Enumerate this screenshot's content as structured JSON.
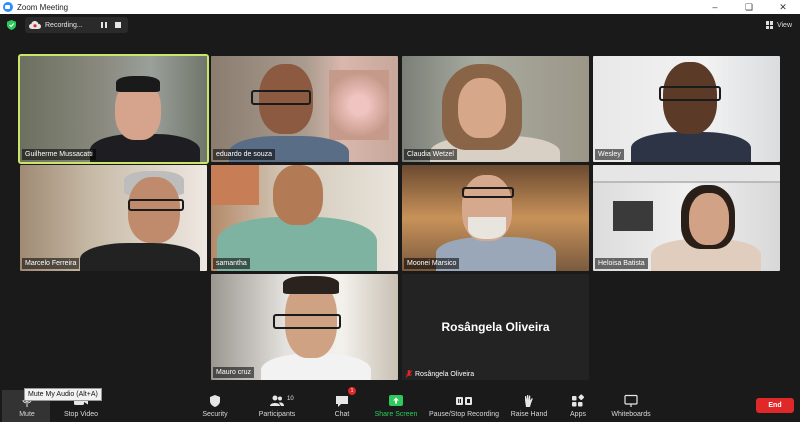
{
  "window": {
    "title": "Zoom Meeting"
  },
  "recording": {
    "label": "Recording..."
  },
  "view": {
    "label": "View"
  },
  "participants": [
    {
      "name": "Guilherme Mussacatti",
      "active": true
    },
    {
      "name": "eduardo de souza"
    },
    {
      "name": "Claudia Wetzel"
    },
    {
      "name": "Wesley"
    },
    {
      "name": "Marcelo Ferreira"
    },
    {
      "name": "samantha"
    },
    {
      "name": "Moonei Marsico"
    },
    {
      "name": "Heloisa Batista"
    },
    {
      "name": "Mauro cruz"
    },
    {
      "name": "Rosângela Oliveira",
      "video_off": true,
      "muted": true
    }
  ],
  "toolbar": {
    "mute": "Mute",
    "mute_tooltip": "Mute My Audio (Alt+A)",
    "stop_video": "Stop Video",
    "security": "Security",
    "participants": "Participants",
    "participants_count": "10",
    "chat": "Chat",
    "chat_badge": "1",
    "share_screen": "Share Screen",
    "record": "Pause/Stop Recording",
    "raise_hand": "Raise Hand",
    "apps": "Apps",
    "whiteboards": "Whiteboards",
    "end": "End"
  },
  "colors": {
    "active_speaker": "#c9e66a",
    "share": "#2ec95c",
    "end": "#e02828"
  }
}
